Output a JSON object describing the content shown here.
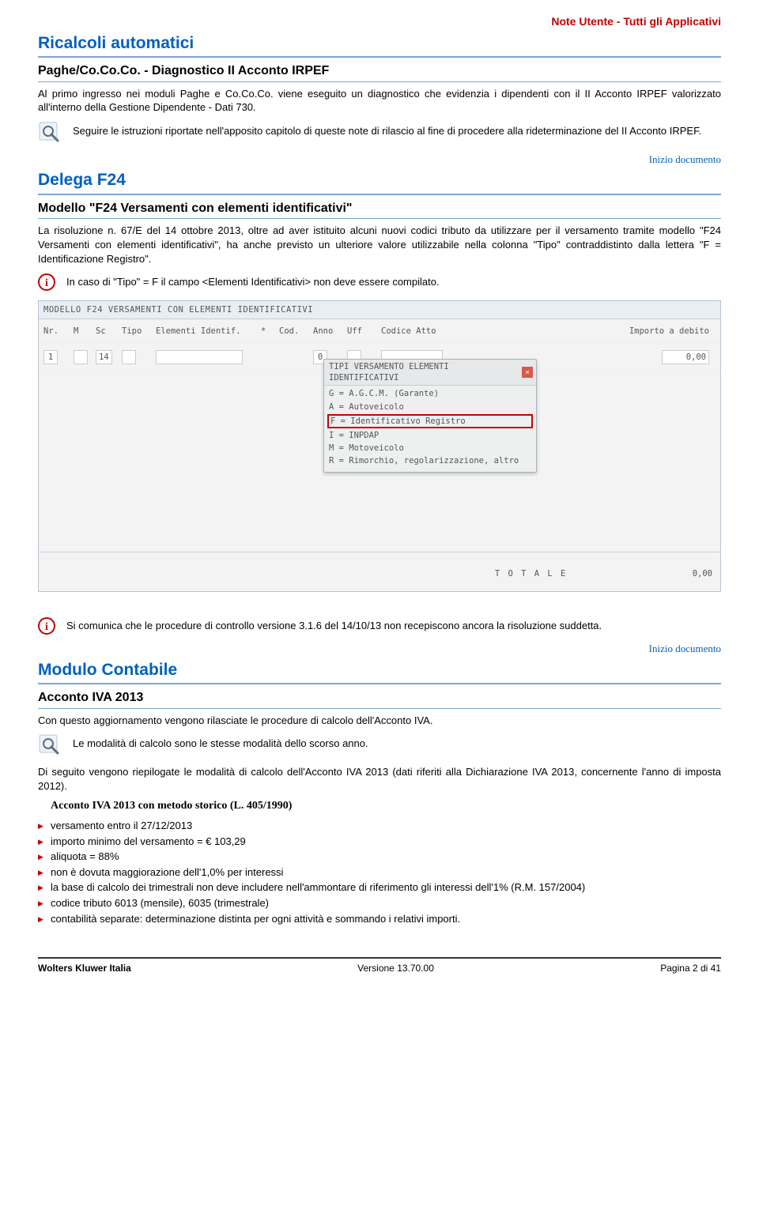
{
  "top_note": "Note Utente - Tutti gli Applicativi",
  "section1": {
    "title": "Ricalcoli automatici",
    "subtitle": "Paghe/Co.Co.Co. - Diagnostico II Acconto IRPEF",
    "p1": "Al primo ingresso nei moduli Paghe e Co.Co.Co. viene eseguito un diagnostico che evidenzia i dipendenti con il II Acconto IRPEF valorizzato all'interno della Gestione Dipendente - Dati 730.",
    "note": "Seguire le istruzioni riportate nell'apposito capitolo di queste note di rilascio al fine di procedere alla rideterminazione del II Acconto IRPEF.",
    "inizio": "Inizio documento"
  },
  "section2": {
    "title": "Delega F24",
    "subtitle": "Modello \"F24 Versamenti con elementi identificativi\"",
    "p1": "La risoluzione n. 67/E del 14 ottobre 2013, oltre ad aver istituito alcuni nuovi codici tributo da utilizzare per il versamento tramite modello \"F24 Versamenti con elementi identificativi\", ha anche previsto un ulteriore valore utilizzabile nella colonna \"Tipo\" contraddistinto dalla lettera \"F = Identificazione Registro\".",
    "info": "In caso di \"Tipo\" = F il campo <Elementi Identificativi> non deve essere compilato."
  },
  "screenshot": {
    "title": "MODELLO F24 VERSAMENTI CON ELEMENTI IDENTIFICATIVI",
    "cols": {
      "nr": "Nr.",
      "m": "M",
      "sc": "Sc",
      "tipo": "Tipo",
      "ei": "Elementi Identif.",
      "star": "*",
      "cod": "Cod.",
      "anno": "Anno",
      "uff": "Uff",
      "ca": "Codice Atto",
      "imp": "Importo a debito"
    },
    "row": {
      "nr": "1",
      "m": "",
      "sc": "14",
      "tipo": "",
      "ei": "",
      "star": "",
      "cod": "",
      "anno": "0",
      "uff": "",
      "ca": "",
      "imp": "0,00"
    },
    "popup_title": "TIPI VERSAMENTO ELEMENTI IDENTIFICATIVI",
    "popup_close": "×",
    "popup_items": {
      "g": "G = A.G.C.M. (Garante)",
      "a": "A = Autoveicolo",
      "f": "F = Identificativo Registro",
      "i": "I = INPDAP",
      "m": "M = Motoveicolo",
      "r": "R = Rimorchio, regolarizzazione, altro"
    },
    "total_label": "T O T A L E",
    "total_value": "0,00"
  },
  "section3": {
    "info": "Si comunica che le procedure di controllo versione 3.1.6 del 14/10/13 non recepiscono ancora la risoluzione suddetta.",
    "inizio": "Inizio documento",
    "title": "Modulo Contabile",
    "subtitle": "Acconto IVA 2013",
    "p1": "Con questo aggiornamento vengono rilasciate le procedure di calcolo dell'Acconto IVA.",
    "note": "Le modalità di calcolo sono le stesse modalità dello scorso anno.",
    "p2": "Di seguito vengono riepilogate le modalità di calcolo dell'Acconto IVA 2013 (dati riferiti alla Dichiarazione IVA 2013, concernente l'anno di imposta 2012).",
    "sub_h": "Acconto IVA 2013 con metodo storico (L. 405/1990)",
    "bullets": {
      "b1": "versamento entro il 27/12/2013",
      "b2": "importo minimo del versamento = € 103,29",
      "b3": "aliquota = 88%",
      "b4": "non è dovuta maggiorazione dell'1,0% per interessi",
      "b5": "la base di calcolo dei trimestrali non deve includere nell'ammontare di riferimento gli interessi dell'1% (R.M. 157/2004)",
      "b6": "codice tributo 6013 (mensile), 6035 (trimestrale)",
      "b7": "contabilità separate: determinazione distinta per ogni attività e sommando i relativi importi."
    }
  },
  "footer": {
    "left": "Wolters Kluwer Italia",
    "center": "Versione  13.70.00",
    "right": "Pagina  2 di 41"
  }
}
